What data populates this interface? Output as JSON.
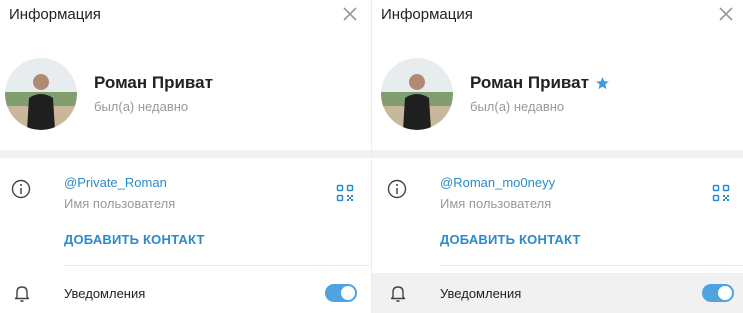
{
  "accent_color": "#2a8bc8",
  "toggle_color": "#4ea3e0",
  "panels": [
    {
      "header_title": "Информация",
      "name": "Роман Приват",
      "verified_star": false,
      "status": "был(а) недавно",
      "username": "@Private_Roman",
      "username_label": "Имя пользователя",
      "add_contact": "ДОБАВИТЬ КОНТАКТ",
      "notifications_label": "Уведомления",
      "notifications_on": true
    },
    {
      "header_title": "Информация",
      "name": "Роман Приват",
      "verified_star": true,
      "status": "был(а) недавно",
      "username": "@Roman_mo0neyy",
      "username_label": "Имя пользователя",
      "add_contact": "ДОБАВИТЬ КОНТАКТ",
      "notifications_label": "Уведомления",
      "notifications_on": true
    }
  ]
}
